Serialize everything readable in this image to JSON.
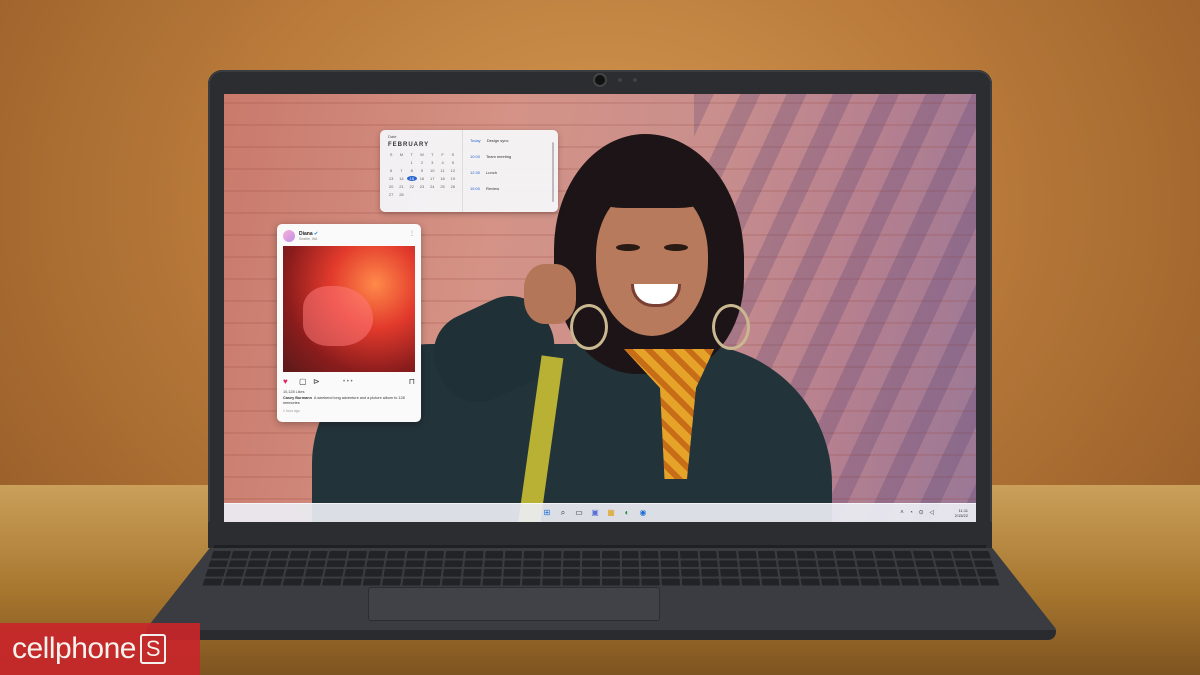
{
  "calendar_widget": {
    "month": "FEBRUARY",
    "header": "Date",
    "weekdays": [
      "S",
      "M",
      "T",
      "W",
      "T",
      "F",
      "S"
    ],
    "days": [
      "",
      "",
      "1",
      "2",
      "3",
      "4",
      "5",
      "6",
      "7",
      "8",
      "9",
      "10",
      "11",
      "12",
      "13",
      "14",
      "15",
      "16",
      "17",
      "18",
      "19",
      "20",
      "21",
      "22",
      "23",
      "24",
      "25",
      "26",
      "27",
      "28",
      "",
      "",
      "",
      "",
      "",
      ""
    ],
    "today": "15",
    "events": [
      {
        "time": "Today",
        "title": "Design sync"
      },
      {
        "time": "10:00",
        "title": "Team meeting"
      },
      {
        "time": "12:30",
        "title": "Lunch"
      },
      {
        "time": "15:00",
        "title": "Review"
      }
    ]
  },
  "social_post": {
    "username": "Diana",
    "verified": "✔",
    "subtitle": "Seattle, WA",
    "likes": "10,128 Likes",
    "caption_user": "Casey Burmann",
    "caption_text": "A weekend long adventure and a picture album to 128 memories",
    "time": "1 hour ago",
    "heart_icon": "♥",
    "comment_icon": "▢",
    "share_icon": "⊳",
    "more_dots": "• • •",
    "save_icon": "⊓",
    "menu_icon": "⋮"
  },
  "taskbar": {
    "icons": [
      "⊞",
      "⌕",
      "▭",
      "▣",
      "▦",
      "◐",
      "◉"
    ],
    "tray_icons": "˄ ◔ ⊙ ◁",
    "time": "11:11",
    "date": "2/15/22"
  },
  "brand": {
    "text": "cellphone",
    "s_letter": "S",
    "color": "#c8262a"
  }
}
